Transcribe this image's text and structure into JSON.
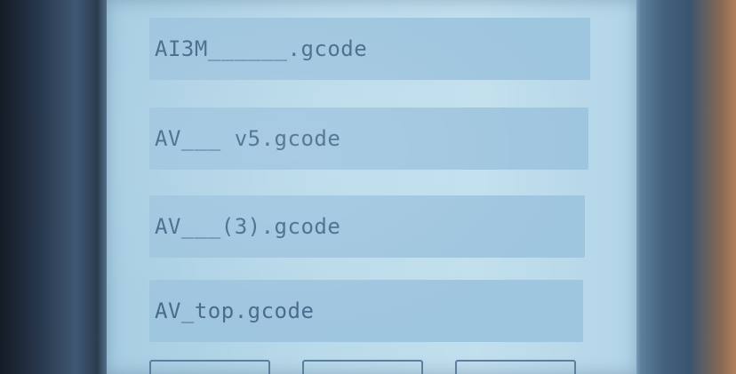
{
  "files": [
    {
      "name": "AI3M______.gcode"
    },
    {
      "name": "AV___ v5.gcode"
    },
    {
      "name": "AV___(3).gcode"
    },
    {
      "name": "AV_top.gcode"
    }
  ],
  "buttons": [
    {
      "label": ""
    },
    {
      "label": ""
    },
    {
      "label": ""
    }
  ],
  "colors": {
    "screen_background": "#b9daea",
    "item_background": "#9fc6df",
    "item_text": "#4a6a8c",
    "button_border": "#5d7f9f"
  }
}
